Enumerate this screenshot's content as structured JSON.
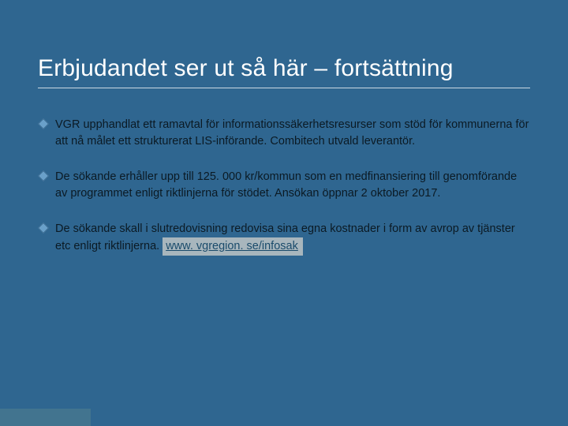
{
  "title": "Erbjudandet ser ut så här – fortsättning",
  "bullets": [
    "VGR upphandlat ett ramavtal för informationssäkerhetsresurser som stöd för kommunerna för att nå målet ett strukturerat LIS-införande. Combitech utvald leverantör.",
    "De sökande erhåller upp till 125. 000 kr/kommun som en medfinansiering till genomförande av programmet enligt riktlinjerna för stödet. Ansökan öppnar 2 oktober 2017.",
    "De sökande skall i slutredovisning redovisa sina egna kostnader i form av avrop av tjänster etc enligt riktlinjerna. "
  ],
  "link_text": "www. vgregion. se/infosak"
}
